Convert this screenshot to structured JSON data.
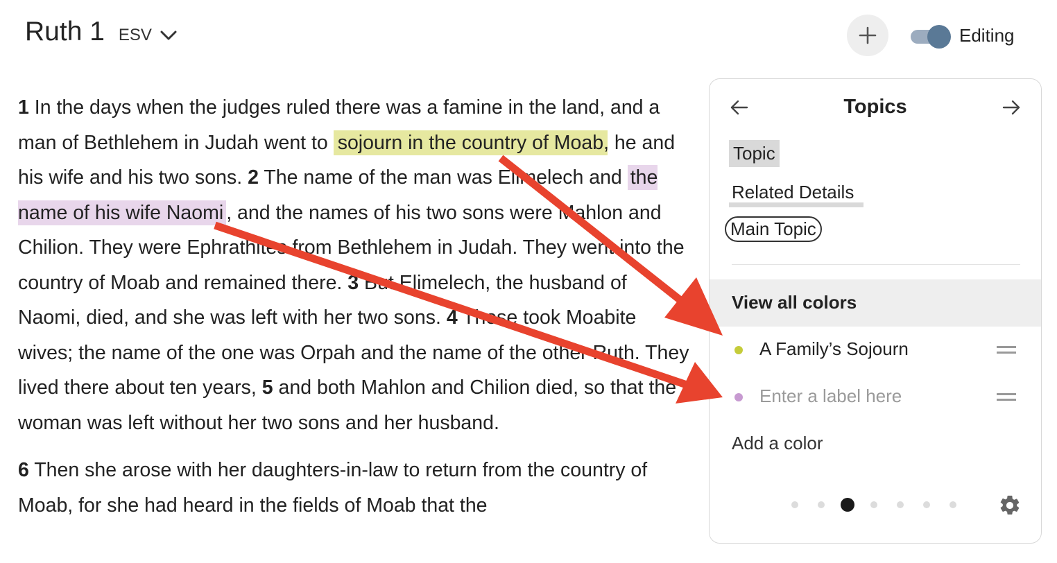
{
  "header": {
    "book": "Ruth 1",
    "version": "ESV",
    "editing_label": "Editing",
    "editing_on": true
  },
  "passage": {
    "p1": {
      "v1_num": "1",
      "v1_a": " In the days when the judges ruled there was a famine in the land, and a man of Bethlehem in Judah went to ",
      "v1_highlight": "sojourn in the country of Moab",
      "v1_b": ", he and his wife and his two sons. ",
      "v2_num": "2",
      "v2_a": " The name of the man was Elimelech and ",
      "v2_highlight": "the name of his wife Naomi",
      "v2_b": ", and the names of his two sons were Mahlon and Chilion. They were Ephrathites from Bethlehem in Judah. They went into the country of Moab and remained there. ",
      "v3_num": "3",
      "v3": " But Elimelech, the husband of Naomi, died, and she was left with her two sons. ",
      "v4_num": "4",
      "v4": " These took Moabite wives; the name of the one was Orpah and the name of the other Ruth. They lived there about ten years, ",
      "v5_num": "5",
      "v5": " and both Mahlon and Chilion died, so that the woman was left without her two sons and her husband."
    },
    "p2": {
      "v6_num": "6",
      "v6": " Then she arose with her daughters-in-law to return from the country of Moab, for she had heard in the fields of Moab that the"
    }
  },
  "panel": {
    "title": "Topics",
    "styles": [
      "Topic",
      "Related Details",
      "Main Topic"
    ],
    "view_all": "View all colors",
    "colors": [
      {
        "label": "A Family’s Sojourn",
        "color": "#c5cc3a"
      },
      {
        "label": "",
        "placeholder": "Enter a label here",
        "color": "#c79ad1"
      }
    ],
    "add_color": "Add a color",
    "pager": {
      "count": 7,
      "active_index": 2
    }
  },
  "annotation_color": "#e8432e",
  "icons": [
    "chevron-down-icon",
    "plus-icon",
    "arrow-left-icon",
    "arrow-right-icon",
    "drag-handle-icon",
    "gear-icon"
  ]
}
